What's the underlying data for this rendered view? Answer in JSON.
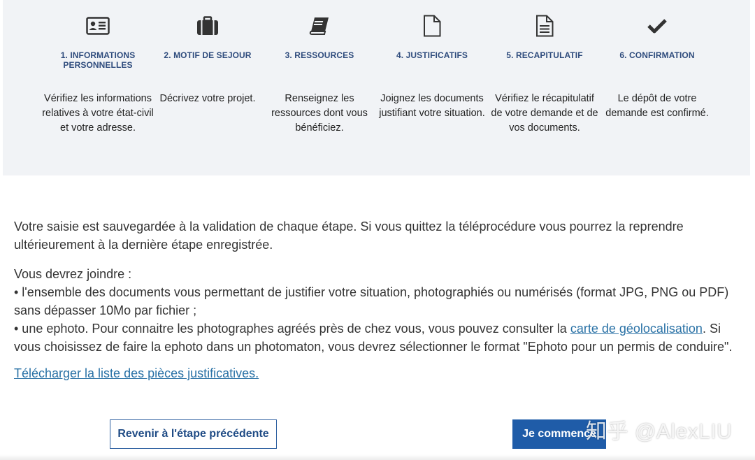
{
  "steps": [
    {
      "icon": "id-card-icon",
      "title": "1. INFORMATIONS PERSONNELLES",
      "desc": "Vérifiez les informations relatives à votre état-civil et votre adresse."
    },
    {
      "icon": "briefcase-icon",
      "title": "2. MOTIF DE SEJOUR",
      "desc": "Décrivez votre projet."
    },
    {
      "icon": "book-icon",
      "title": "3. RESSOURCES",
      "desc": "Renseignez les ressources dont vous bénéficiez."
    },
    {
      "icon": "file-icon",
      "title": "4. JUSTIFICATIFS",
      "desc": "Joignez les documents justifiant votre situation."
    },
    {
      "icon": "file-text-icon",
      "title": "5. RECAPITULATIF",
      "desc": "Vérifiez le récapitulatif de votre demande et de vos documents."
    },
    {
      "icon": "checkmark-icon",
      "title": "6. CONFIRMATION",
      "desc": "Le dépôt de votre demande est confirmé."
    }
  ],
  "content": {
    "save_note": "Votre saisie est sauvegardée à la validation de chaque étape. Si vous quittez la téléprocédure vous pourrez la reprendre ultérieurement à la dernière étape enregistrée.",
    "join_intro": "Vous devrez joindre :",
    "bullet_docs": "• l'ensemble des documents vous permettant de justifier votre situation, photographiés ou numérisés (format JPG, PNG ou PDF) sans dépasser 10Mo par fichier ;",
    "bullet_ephoto_start": "• une ephoto. Pour connaitre les photographes agréés près de chez vous, vous pouvez consulter la ",
    "geoloc_link": "carte de géolocalisation",
    "bullet_ephoto_end": ". Si vous choisissez de faire la ephoto dans un photomaton, vous devrez sélectionner le format \"Ephoto pour un permis de conduire\".",
    "download_link": "Télécharger la liste des pièces justificatives."
  },
  "buttons": {
    "back_label": "Revenir à l'étape précédente",
    "start_label": "Je commence"
  },
  "watermark": "知乎 @AlexLIU",
  "colors": {
    "panel_bg": "#f1f3f6",
    "step_title": "#2f4c7d",
    "link": "#2a72a6",
    "primary_button": "#1f5ca8"
  }
}
